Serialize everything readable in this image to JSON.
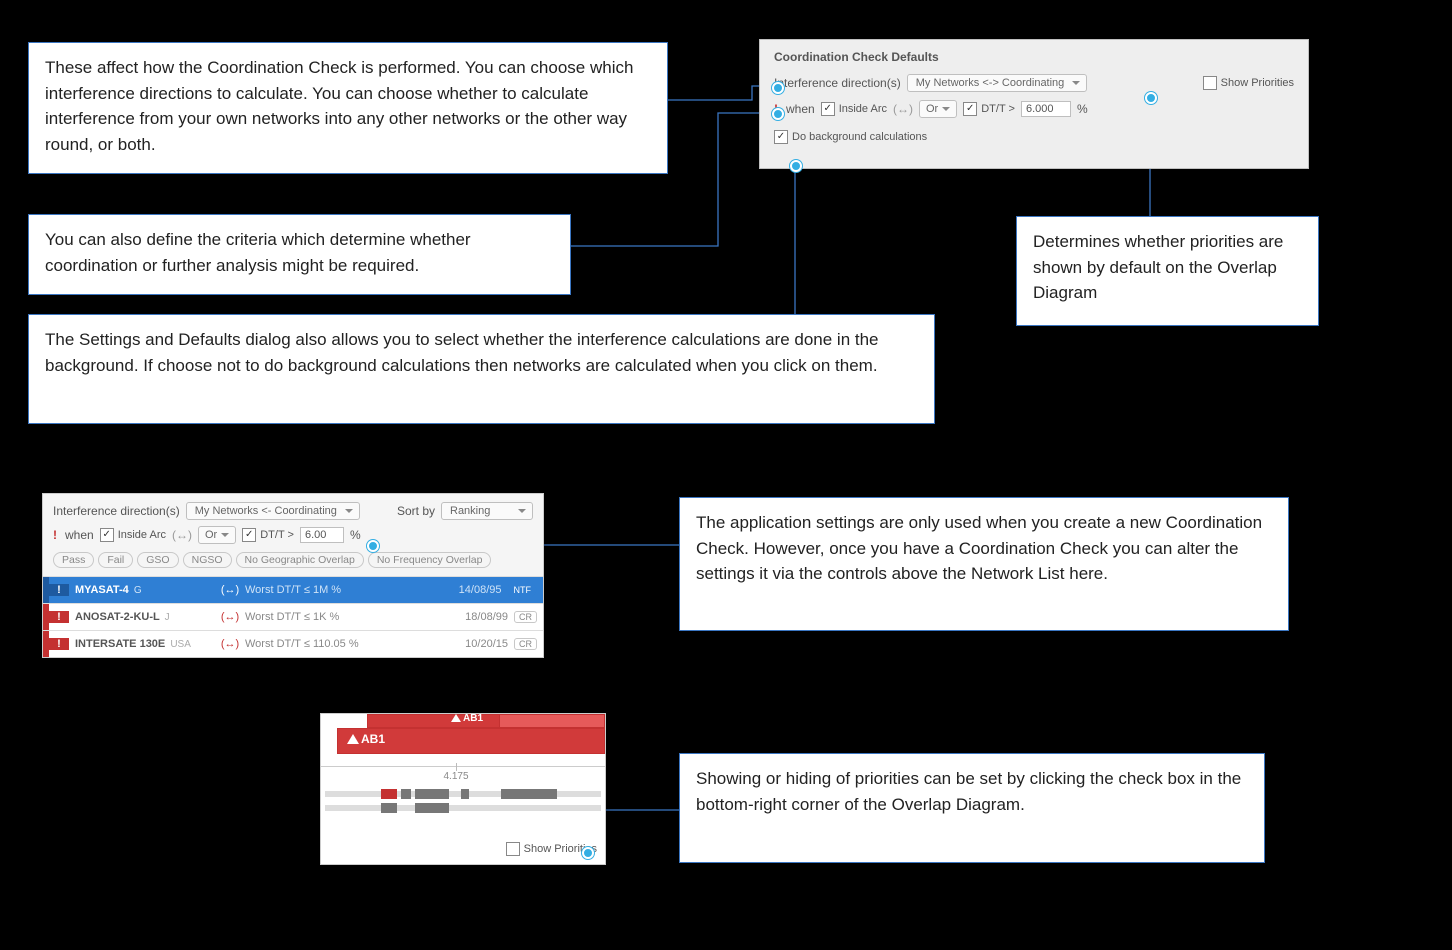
{
  "callouts": {
    "c1": "These affect how the Coordination Check is performed. You can choose which interference directions to calculate.  You can choose whether to calculate interference from your own networks into any other networks or the other way round, or both.",
    "c2": "You can also define the criteria which determine whether coordination or further analysis might be required.",
    "c3": "The Settings and Defaults dialog also allows you to select whether the interference calculations are done in the background. If choose not to do background calculations then networks are calculated when you click on them.",
    "c4": "Determines whether priorities are shown by default on the Overlap Diagram",
    "c5": "The application settings are only used when you create a new Coordination Check. However, once you have a Coordination Check you can alter the settings it via the controls above the Network List here.",
    "c6": "Showing or hiding of priorities can be set by clicking the check box in the bottom-right corner of the Overlap Diagram."
  },
  "defaults": {
    "title": "Coordination Check Defaults",
    "dir_label": "Interference direction(s)",
    "dir_value": "My Networks <-> Coordinating",
    "show_priorities": "Show Priorities",
    "when": "when",
    "inside_arc": "Inside Arc",
    "logic": "Or",
    "dtt_label": "DT/T >",
    "dtt_value": "6.000",
    "pct": "%",
    "bg": "Do background calculations"
  },
  "filters": {
    "dir_label": "Interference direction(s)",
    "dir_value": "My Networks <- Coordinating",
    "sort_label": "Sort by",
    "sort_value": "Ranking",
    "when": "when",
    "inside_arc": "Inside Arc",
    "logic": "Or",
    "dtt_label": "DT/T >",
    "dtt_value": "6.00",
    "pct": "%",
    "pills": [
      "Pass",
      "Fail",
      "GSO",
      "NGSO",
      "No Geographic Overlap",
      "No Frequency Overlap"
    ],
    "rows": [
      {
        "name": "MYASAT-4",
        "cc": "G",
        "dir": "(↔)",
        "worst": "Worst DT/T ≤ 1M %",
        "date": "14/08/95",
        "tag": "NTF",
        "sel": true
      },
      {
        "name": "ANOSAT-2-KU-L",
        "cc": "J",
        "dir": "(↔)",
        "worst": "Worst DT/T ≤ 1K %",
        "date": "18/08/99",
        "tag": "CR",
        "sel": false
      },
      {
        "name": "INTERSATE 130E",
        "cc": "USA",
        "dir": "(↔)",
        "worst": "Worst DT/T ≤ 110.05 %",
        "date": "10/20/15",
        "tag": "CR",
        "sel": false
      }
    ]
  },
  "overlap": {
    "ab1": "AB1",
    "tick": "4.175",
    "show_priorities": "Show Priorities"
  }
}
